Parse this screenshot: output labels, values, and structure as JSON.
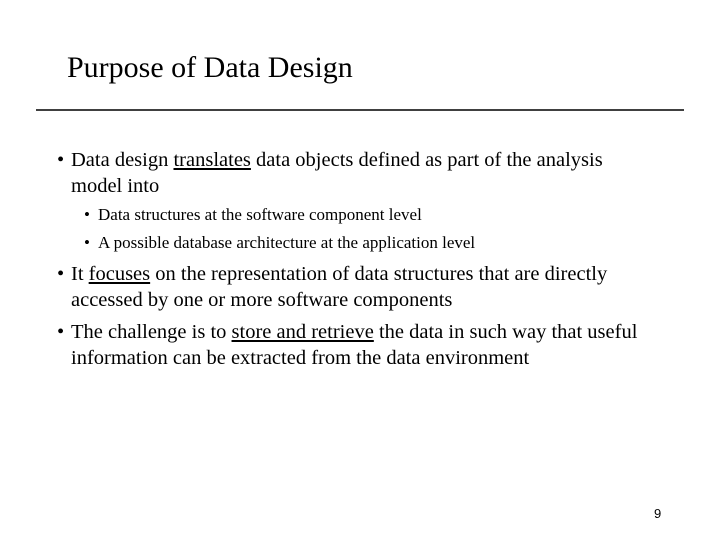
{
  "slide": {
    "title": "Purpose of Data Design",
    "page_number": "9",
    "bullets": [
      {
        "pre": "Data design ",
        "underlined": "translates",
        "post": " data objects defined as part of the analysis model into",
        "sub_bullets": [
          "Data structures at the software component level",
          "A possible database architecture at the application level"
        ]
      },
      {
        "pre": "It ",
        "underlined": "focuses",
        "post": " on the representation of data structures that are directly accessed by one or more software components"
      },
      {
        "pre": "The challenge is to ",
        "underlined": "store and retrieve",
        "post": " the data in such way that useful information can be extracted from the data environment"
      }
    ],
    "bullet_glyph": "•"
  }
}
